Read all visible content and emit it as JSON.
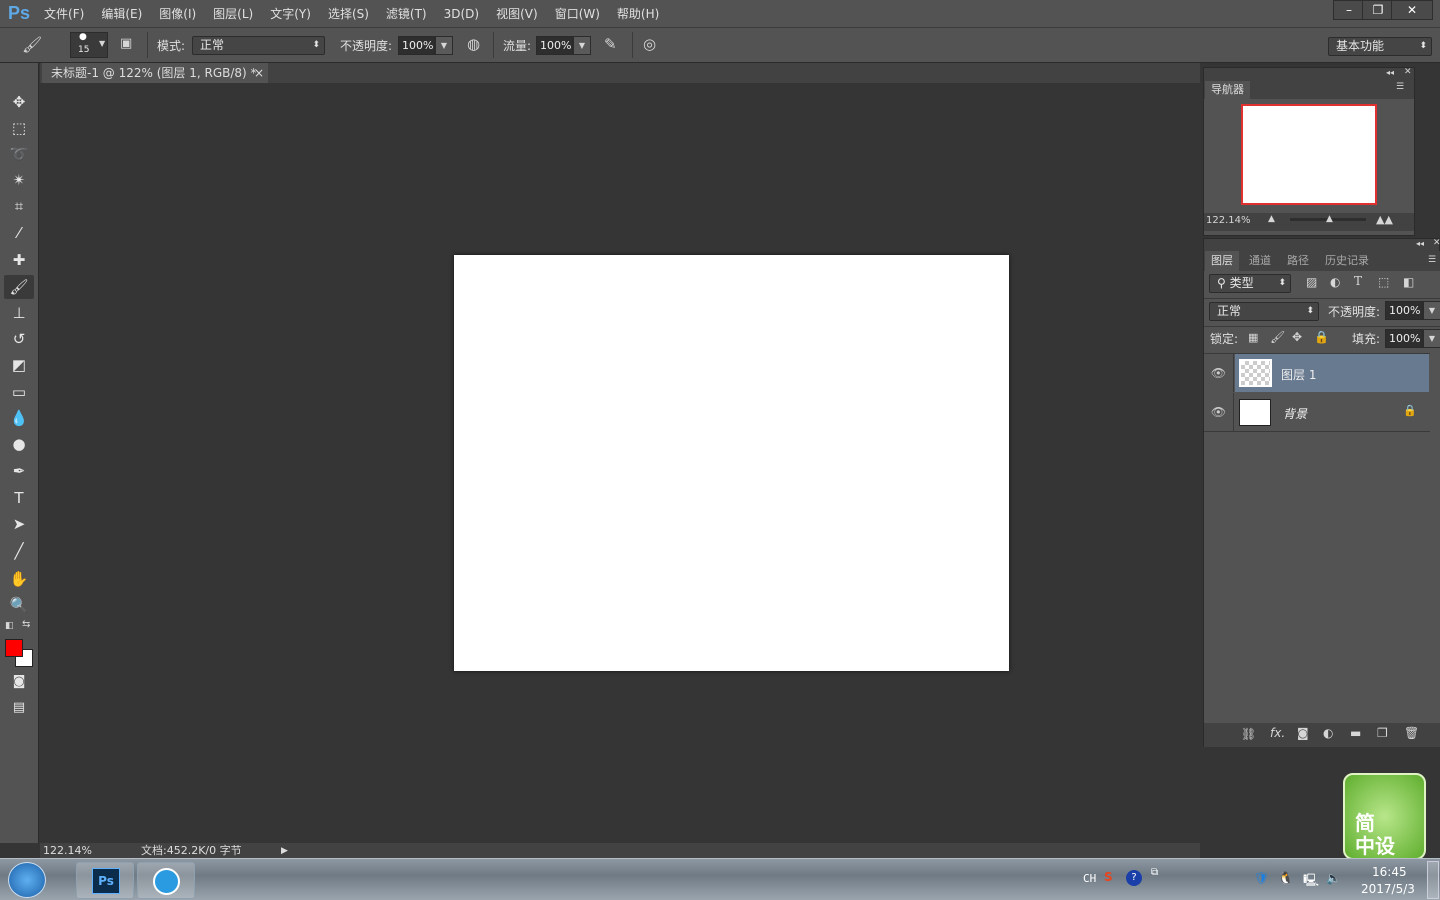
{
  "app": {
    "logo": "Ps"
  },
  "menu": [
    "文件(F)",
    "编辑(E)",
    "图像(I)",
    "图层(L)",
    "文字(Y)",
    "选择(S)",
    "滤镜(T)",
    "3D(D)",
    "视图(V)",
    "窗口(W)",
    "帮助(H)"
  ],
  "window_controls": {
    "minimize": "–",
    "restore": "❐",
    "close": "✕"
  },
  "options": {
    "brush_size": "15",
    "mode_label": "模式:",
    "mode_value": "正常",
    "opacity_label": "不透明度:",
    "opacity_value": "100%",
    "flow_label": "流量:",
    "flow_value": "100%",
    "workspace": "基本功能"
  },
  "document_tab": {
    "title": "未标题-1 @ 122% (图层 1, RGB/8) *",
    "close": "×"
  },
  "navigator": {
    "tab": "导航器",
    "zoom": "122.14%"
  },
  "layers_panel": {
    "tabs": [
      "图层",
      "通道",
      "路径",
      "历史记录"
    ],
    "filter": "类型",
    "blend_mode": "正常",
    "opacity_label": "不透明度:",
    "opacity_value": "100%",
    "lock_label": "锁定:",
    "fill_label": "填充:",
    "fill_value": "100%",
    "layers": [
      {
        "name": "图层 1",
        "selected": true
      },
      {
        "name": "背景",
        "locked": true
      }
    ]
  },
  "status": {
    "zoom": "122.14%",
    "doc": "文档:452.2K/0 字节"
  },
  "colors": {
    "foreground": "#ff0000",
    "background": "#ffffff",
    "selected_layer": "#687a8f"
  },
  "widget": {
    "text1": "简",
    "text2": "中设"
  },
  "taskbar": {
    "lang": "CH",
    "time": "16:45",
    "date": "2017/5/3"
  }
}
